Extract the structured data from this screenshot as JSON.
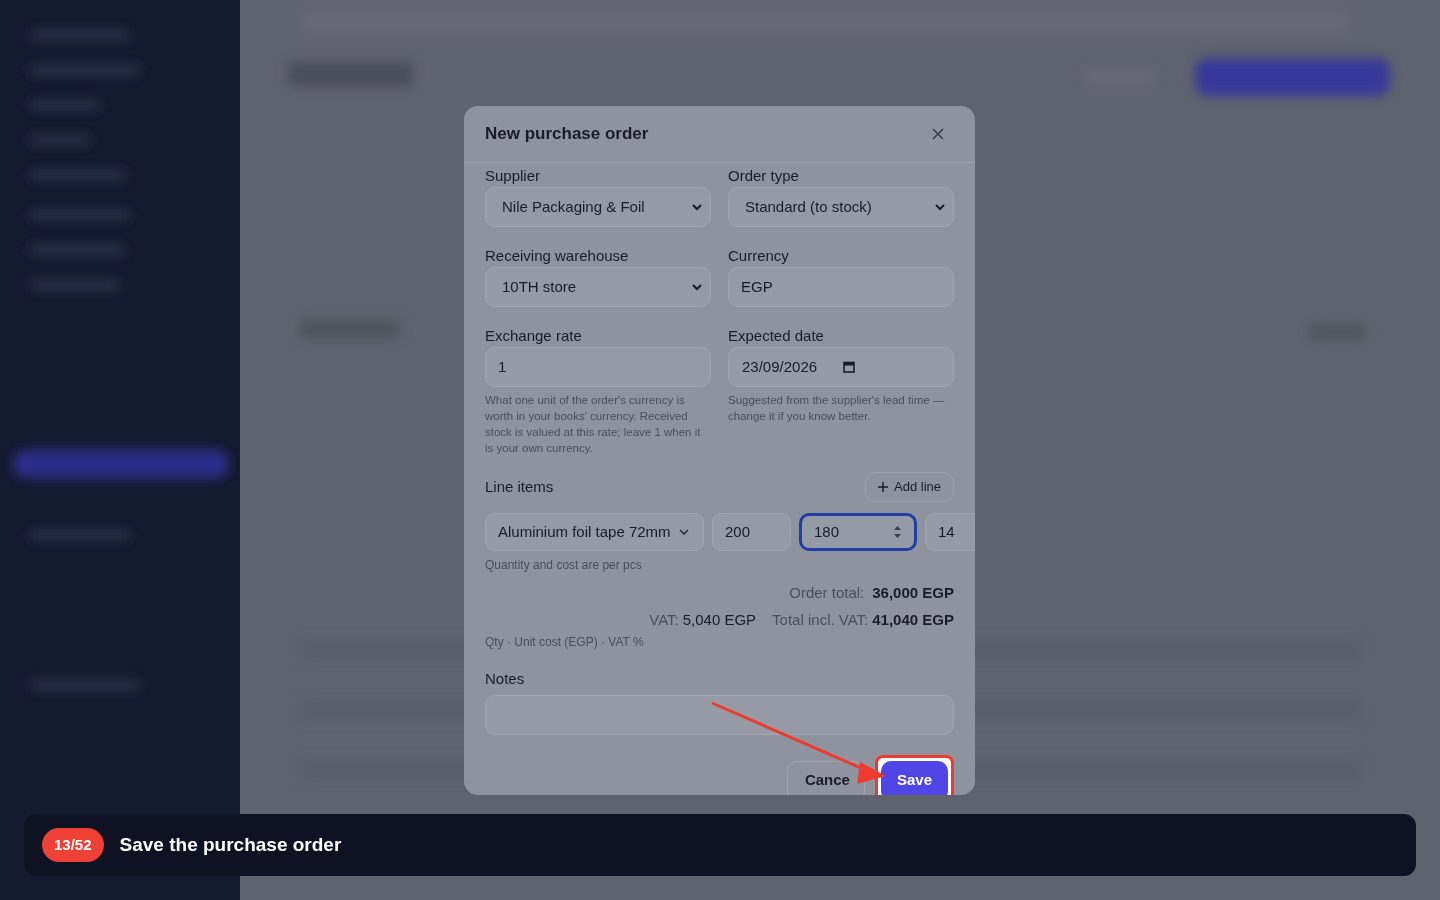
{
  "dialog": {
    "title": "New purchase order",
    "fields": [
      {
        "label": "Supplier",
        "kind": "select",
        "value": "Nile Packaging & Foil"
      },
      {
        "label": "Order type",
        "kind": "select",
        "value": "Standard (to stock)"
      },
      {
        "label": "Receiving warehouse",
        "kind": "select",
        "value": "10TH store"
      },
      {
        "label": "Currency",
        "kind": "input",
        "value": "EGP"
      },
      {
        "label": "Exchange rate",
        "kind": "input",
        "value": "1",
        "help": "What one unit of the order's currency is worth in your books' currency. Received stock is valued at this rate; leave 1 when it is your own currency."
      },
      {
        "label": "Expected date",
        "kind": "date",
        "value": "23/09/2026",
        "help": "Suggested from the supplier's lead time — change it if you know better."
      }
    ],
    "line_items": {
      "label": "Line items",
      "add_button": "Add line",
      "row": [
        {
          "kind": "select",
          "value": "Aluminium foil tape 72mm",
          "focused": false
        },
        {
          "kind": "input",
          "value": "200",
          "focused": false
        },
        {
          "kind": "number",
          "value": "180",
          "focused": true
        },
        {
          "kind": "input",
          "value": "14",
          "focused": false
        }
      ],
      "hint": "Quantity and cost are per pcs",
      "order_total_label": "Order total:",
      "order_total": "36,000 EGP",
      "vat_label": "VAT:",
      "vat": "5,040 EGP",
      "total_incl_label": "Total incl. VAT:",
      "total_incl": "41,040 EGP",
      "columns_hint": "Qty · Unit cost (EGP) · VAT %"
    },
    "notes_label": "Notes",
    "actions": [
      {
        "label": "Cance",
        "highlighted": false
      },
      {
        "label": "Save",
        "highlighted": true
      }
    ]
  },
  "tutorial": {
    "step": "13/52",
    "text": "Save the purchase order"
  }
}
